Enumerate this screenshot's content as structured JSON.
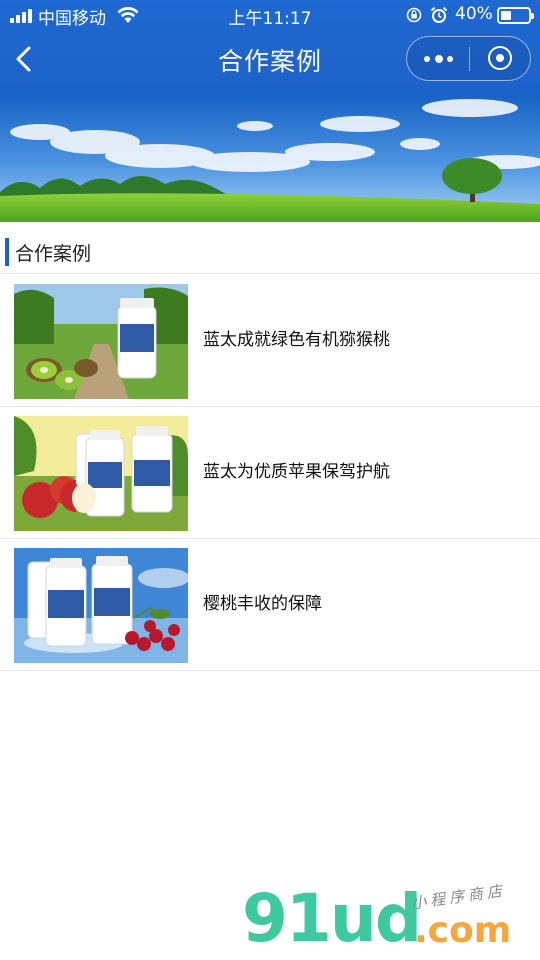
{
  "status_bar": {
    "carrier": "中国移动",
    "time": "上午11:17",
    "battery_percent": "40%",
    "battery_level": 0.4
  },
  "nav": {
    "title": "合作案例"
  },
  "section": {
    "title": "合作案例"
  },
  "cases": [
    {
      "title": "蓝太成就绿色有机猕猴桃",
      "fruit": "kiwi"
    },
    {
      "title": "蓝太为优质苹果保驾护航",
      "fruit": "apple"
    },
    {
      "title": "樱桃丰收的保障",
      "fruit": "cherry"
    }
  ],
  "watermark": {
    "main": "91ud",
    "com": ".com",
    "tag": "小程序商店"
  },
  "colors": {
    "accent": "#1d62c8",
    "divider": "#e5e5e5"
  }
}
